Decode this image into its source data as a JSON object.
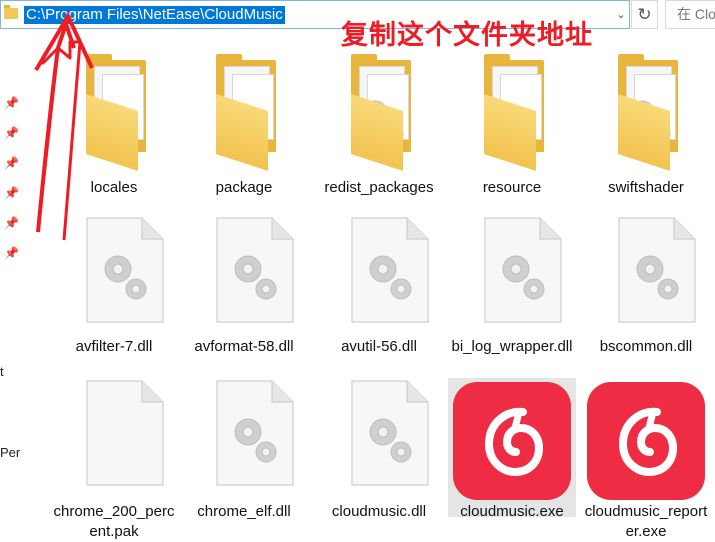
{
  "address_bar": {
    "path": "C:\\Program Files\\NetEase\\CloudMusic",
    "dropdown_glyph": "⌄",
    "refresh_glyph": "↻",
    "search_placeholder": "在 Clo"
  },
  "annotation": {
    "text": "复制这个文件夹地址",
    "color": "#ee1c24"
  },
  "nav": {
    "fragments": [
      "t",
      "Per"
    ]
  },
  "files": [
    {
      "name": "locales",
      "type": "folder",
      "icon": "folder-icon"
    },
    {
      "name": "package",
      "type": "folder",
      "icon": "folder-icon"
    },
    {
      "name": "redist_packages",
      "type": "folder-settings",
      "icon": "folder-icon"
    },
    {
      "name": "resource",
      "type": "folder",
      "icon": "folder-icon"
    },
    {
      "name": "swiftshader",
      "type": "folder-settings",
      "icon": "folder-icon"
    },
    {
      "name": "avfilter-7.dll",
      "type": "dll",
      "icon": "dll-file-icon"
    },
    {
      "name": "avformat-58.dll",
      "type": "dll",
      "icon": "dll-file-icon"
    },
    {
      "name": "avutil-56.dll",
      "type": "dll",
      "icon": "dll-file-icon"
    },
    {
      "name": "bi_log_wrapper.dll",
      "type": "dll",
      "icon": "dll-file-icon"
    },
    {
      "name": "bscommon.dll",
      "type": "dll",
      "icon": "dll-file-icon"
    },
    {
      "name": "chrome_200_percent.pak",
      "type": "blank",
      "icon": "file-icon"
    },
    {
      "name": "chrome_elf.dll",
      "type": "dll",
      "icon": "dll-file-icon"
    },
    {
      "name": "cloudmusic.dll",
      "type": "dll",
      "icon": "dll-file-icon"
    },
    {
      "name": "cloudmusic.exe",
      "type": "exe",
      "icon": "netease-cloudmusic-icon",
      "state": "hovered"
    },
    {
      "name": "cloudmusic_reporter.exe",
      "type": "exe",
      "icon": "netease-cloudmusic-icon"
    }
  ],
  "colors": {
    "selection": "#0078d7",
    "folder": "#f2c34f",
    "app_red": "#ee2d45"
  }
}
